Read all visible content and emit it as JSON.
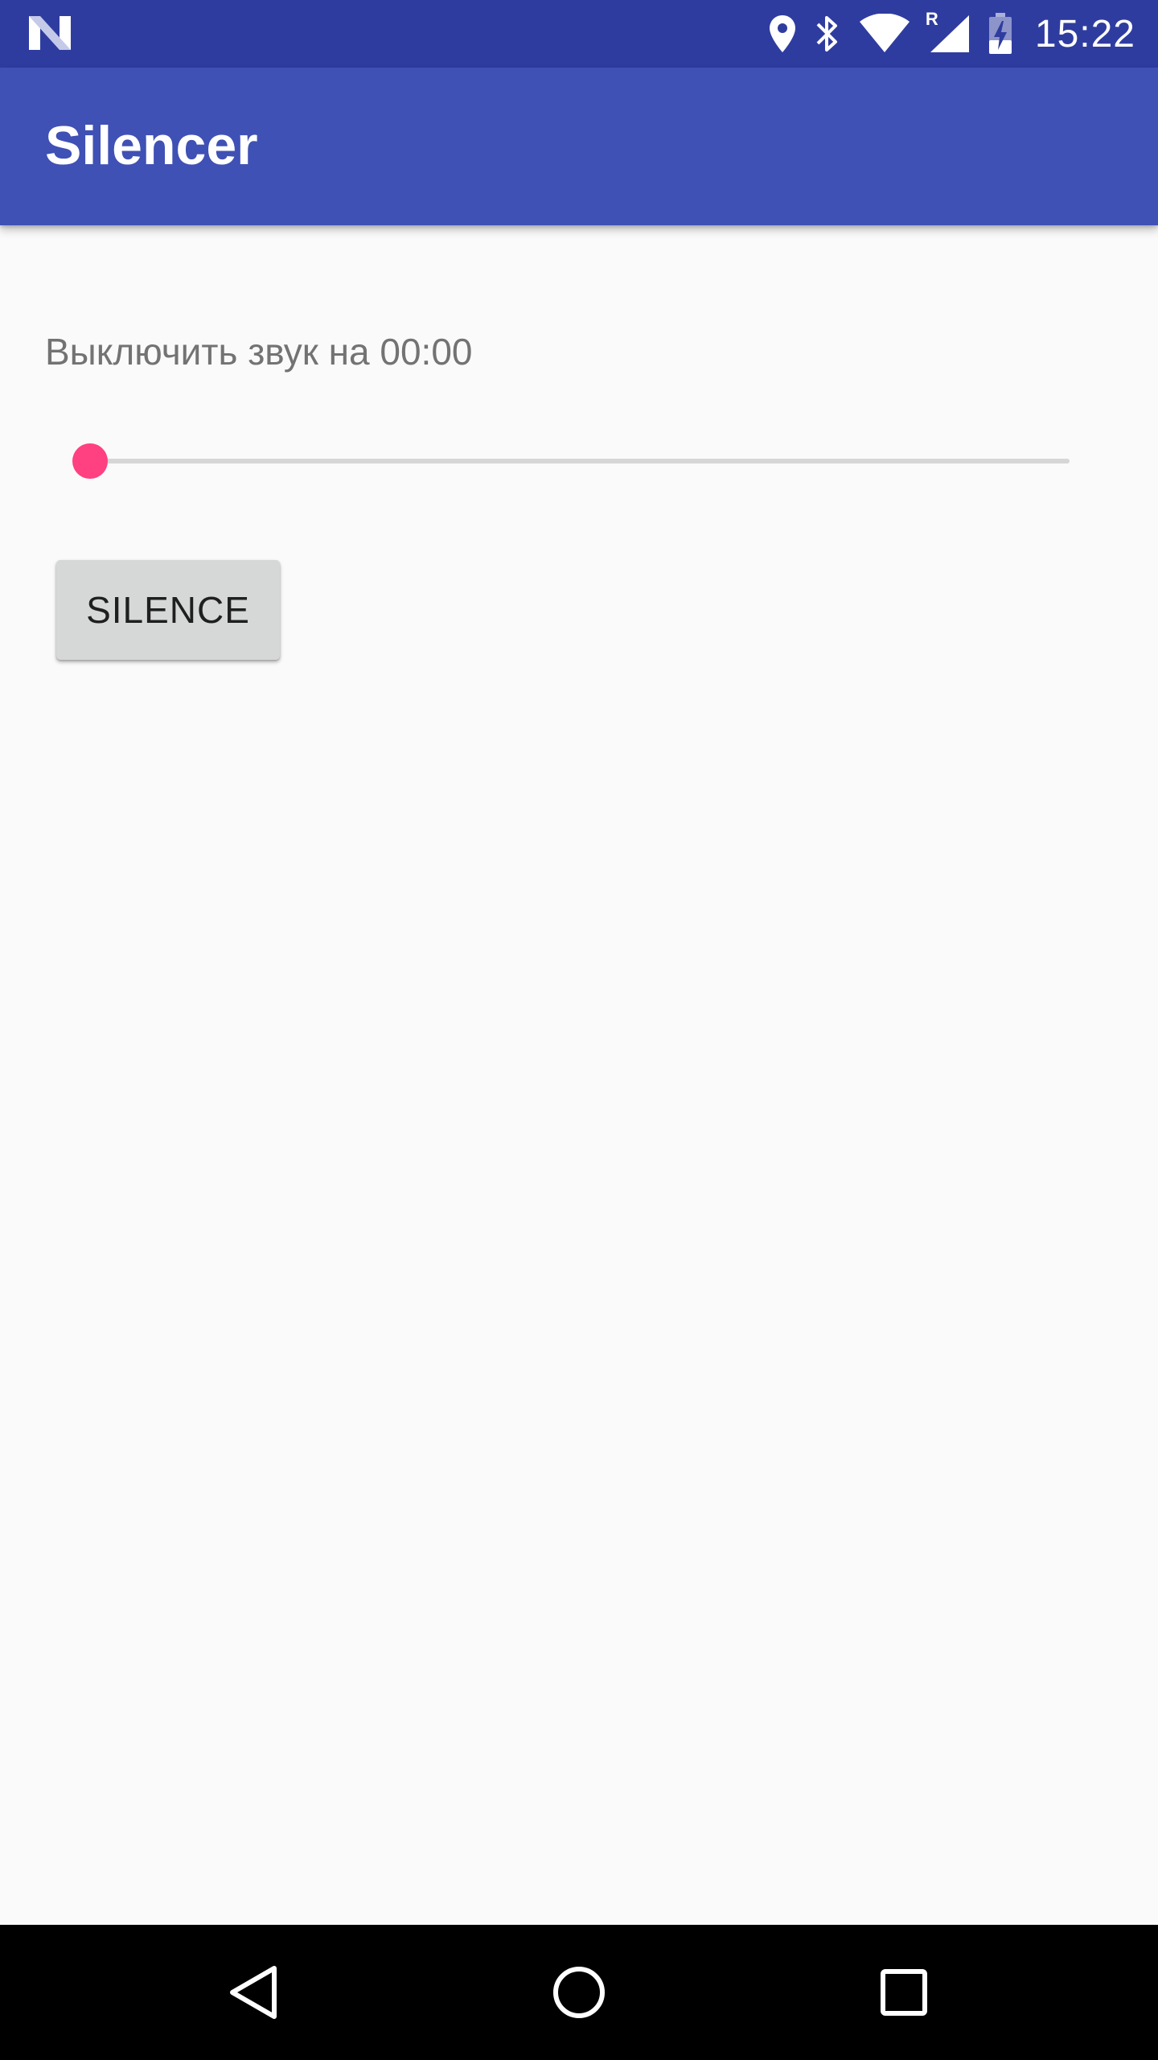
{
  "status_bar": {
    "time": "15:22",
    "roaming_indicator": "R",
    "icons": [
      "android-n-notification-icon",
      "location-icon",
      "bluetooth-icon",
      "wifi-icon",
      "cellular-signal-icon",
      "battery-charging-icon"
    ],
    "background_color": "#2f3c9f"
  },
  "app_bar": {
    "title": "Silencer",
    "background_color": "#3f51b5"
  },
  "main": {
    "silence_label": "Выключить звук на 00:00",
    "seekbar": {
      "progress": 0,
      "accent_color": "#ff4081",
      "track_color": "#d6d6d6"
    },
    "silence_button_label": "SILENCE"
  },
  "nav_bar": {
    "icons": [
      "back-icon",
      "home-icon",
      "recents-icon"
    ]
  }
}
